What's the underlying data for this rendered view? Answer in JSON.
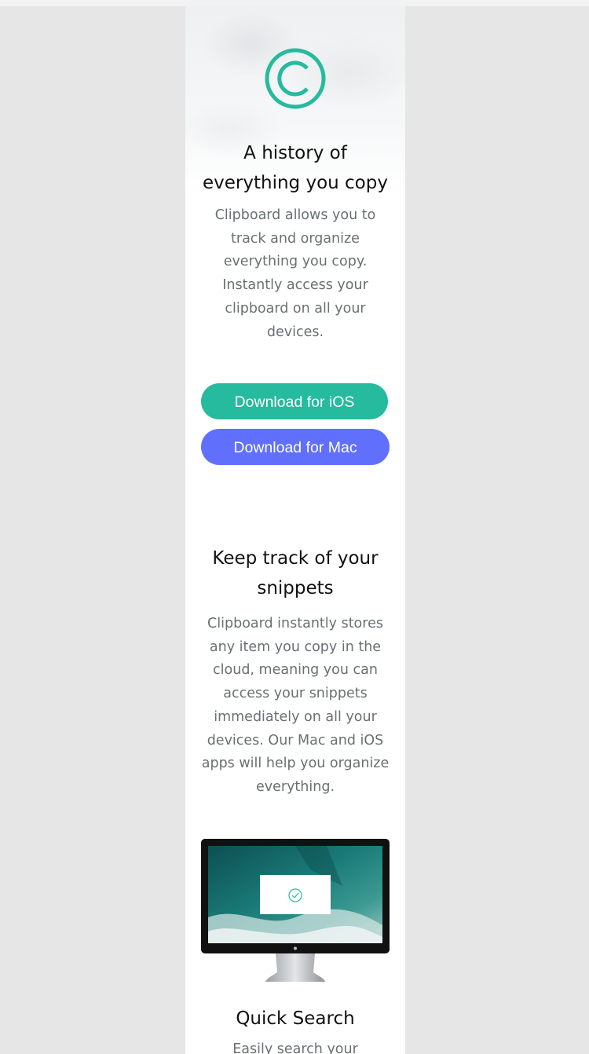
{
  "hero": {
    "title": "A history of everything you copy",
    "description": "Clipboard allows you to track and organize everything you copy. Instantly access your clipboard on all your devices.",
    "ios_button": "Download for iOS",
    "mac_button": "Download for Mac"
  },
  "snippets": {
    "title": "Keep track of your snippets",
    "description": "Clipboard instantly stores any item you copy in the cloud, meaning you can access your snippets immediately on all your devices. Our Mac and iOS apps will help you organize everything."
  },
  "features": [
    {
      "title": "Quick Search",
      "description_partial": "Easily search your"
    }
  ],
  "colors": {
    "accent_green": "#26ba9e",
    "accent_blue": "#6070fd",
    "heading": "#111111",
    "body_text": "#6a6f73",
    "background": "#e6e6e6"
  },
  "icons": {
    "logo": "copyright-circle-icon",
    "monitor_badge": "check-circle-icon"
  }
}
